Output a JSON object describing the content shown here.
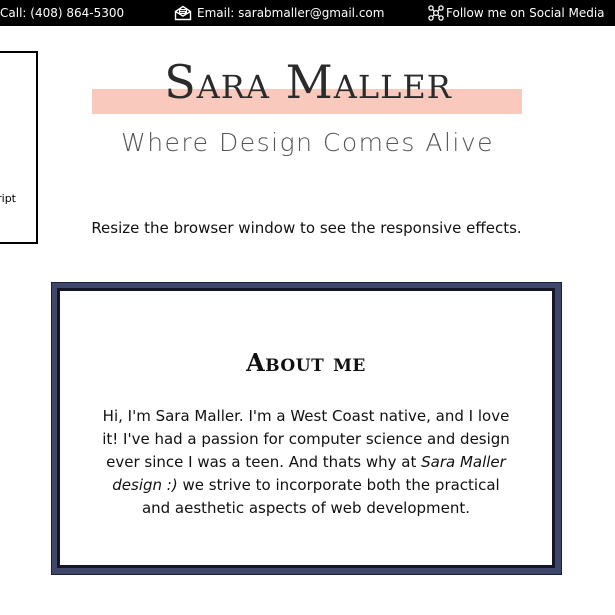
{
  "topbar": {
    "call": "Call: (408) 864-5300",
    "email": "Email: sarabmaller@gmail.com",
    "social": "Follow me on Social Media",
    "icons": {
      "email": "envelope-icon",
      "social": "social-network-icon"
    }
  },
  "sidebar": {
    "visible_link": "ript"
  },
  "header": {
    "title": "Sara Maller",
    "tagline": "Where Design Comes Alive",
    "highlight_color": "#f9c9bd"
  },
  "notice": {
    "text": "Resize the browser window to see the responsive effects."
  },
  "about": {
    "heading": "About me",
    "text_before": "Hi, I'm Sara Maller. I'm a West Coast native, and I love it! I've had a passion for computer science and design ever since I was a teen. And thats why at ",
    "text_emphasis": "Sara Maller design :)",
    "text_after": " we strive to incorporate both the practical and aesthetic aspects of web development.",
    "frame_color": "#3e476a"
  }
}
